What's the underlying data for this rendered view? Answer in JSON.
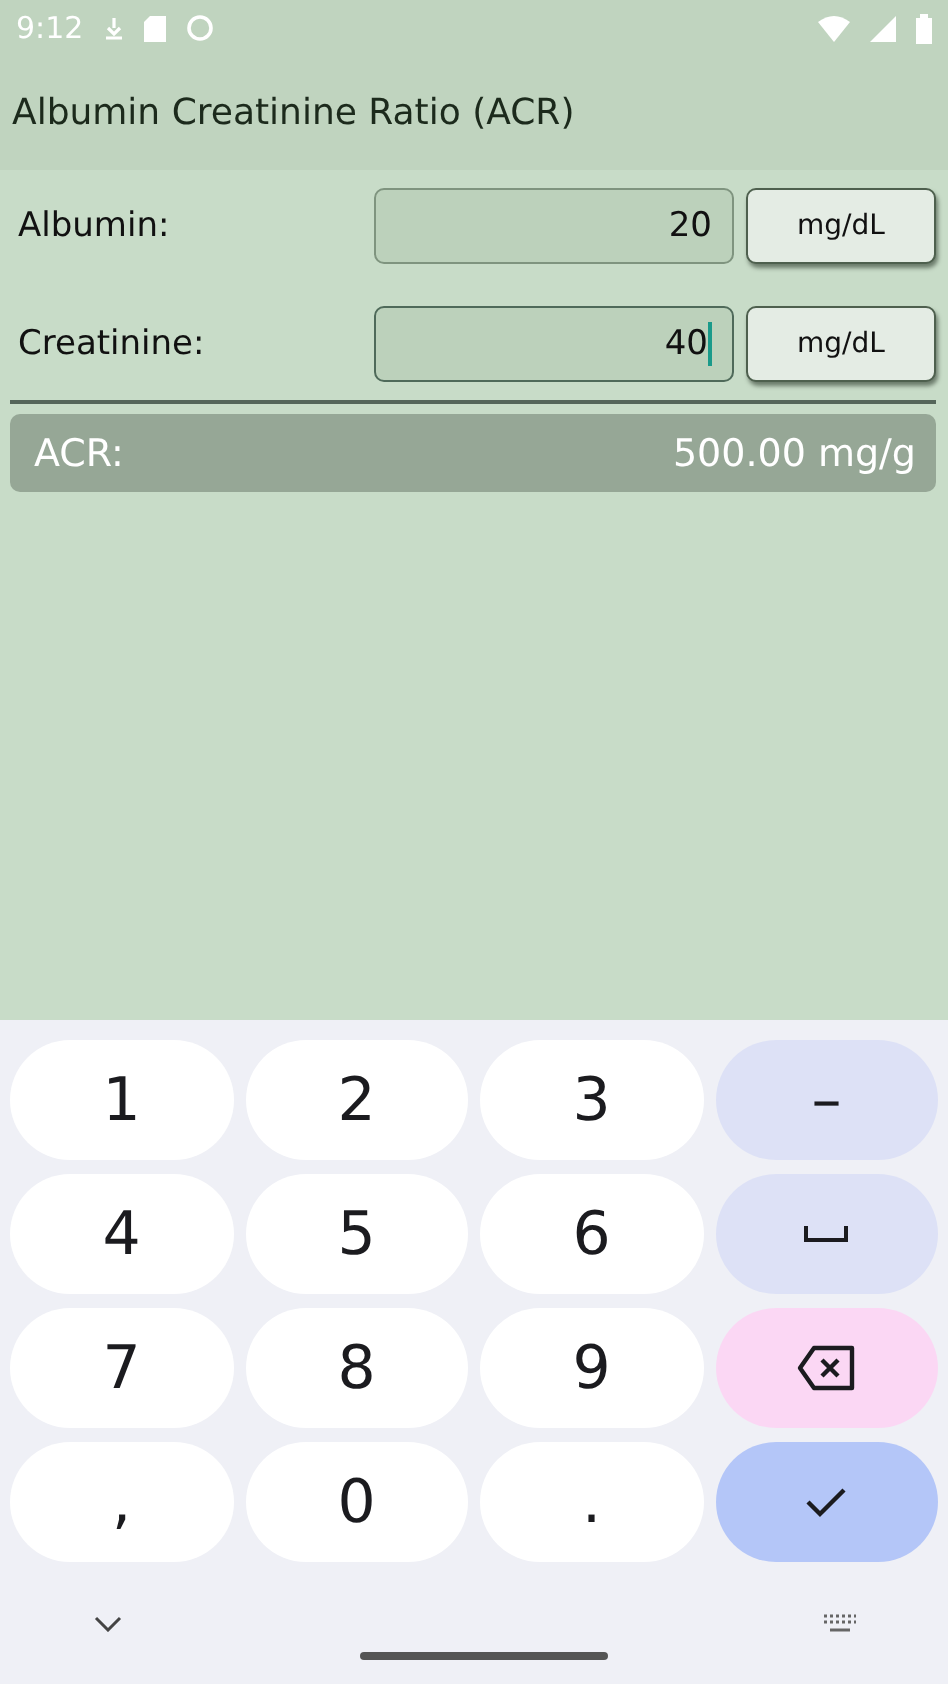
{
  "status_bar": {
    "time": "9:12"
  },
  "title": "Albumin Creatinine Ratio (ACR)",
  "inputs": [
    {
      "label": "Albumin:",
      "value": "20",
      "unit": "mg/dL",
      "focused": false
    },
    {
      "label": "Creatinine:",
      "value": "40",
      "unit": "mg/dL",
      "focused": true
    }
  ],
  "result": {
    "label": "ACR:",
    "value": "500.00 mg/g"
  },
  "keyboard": {
    "keys": [
      {
        "kind": "digit",
        "label": "1"
      },
      {
        "kind": "digit",
        "label": "2"
      },
      {
        "kind": "digit",
        "label": "3"
      },
      {
        "kind": "symbol",
        "label": "–"
      },
      {
        "kind": "digit",
        "label": "4"
      },
      {
        "kind": "digit",
        "label": "5"
      },
      {
        "kind": "digit",
        "label": "6"
      },
      {
        "kind": "space"
      },
      {
        "kind": "digit",
        "label": "7"
      },
      {
        "kind": "digit",
        "label": "8"
      },
      {
        "kind": "digit",
        "label": "9"
      },
      {
        "kind": "backspace"
      },
      {
        "kind": "digit",
        "label": ","
      },
      {
        "kind": "digit",
        "label": "0"
      },
      {
        "kind": "digit",
        "label": "."
      },
      {
        "kind": "enter"
      }
    ]
  }
}
